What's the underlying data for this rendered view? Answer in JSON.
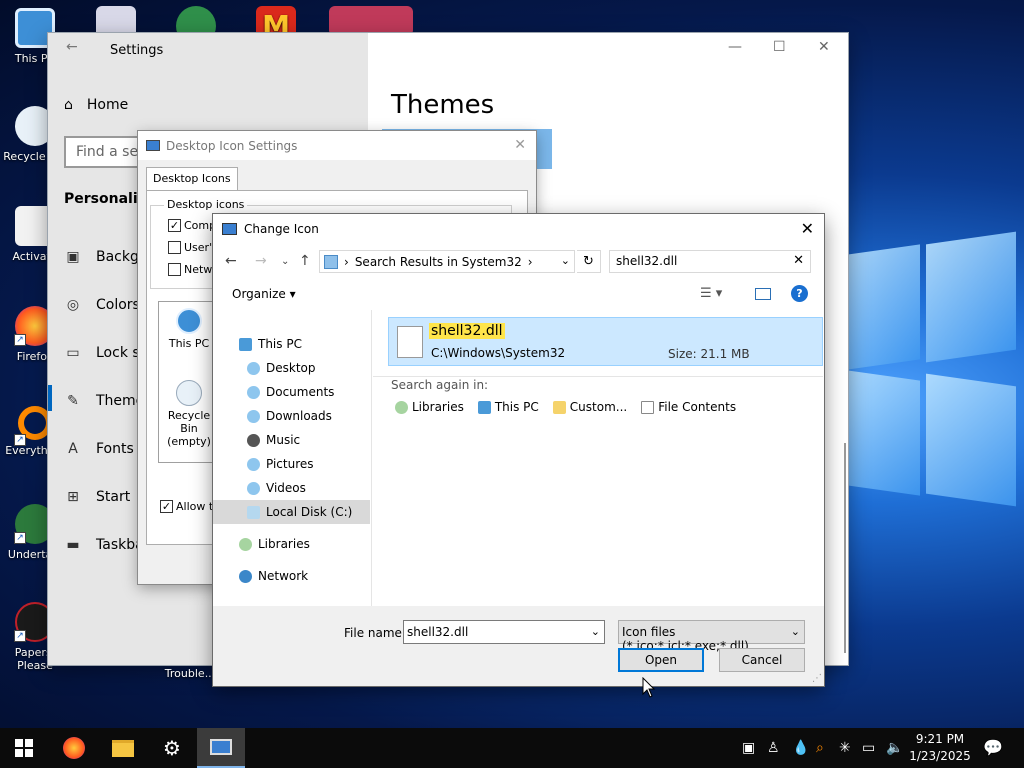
{
  "desktop": {
    "icons": [
      {
        "label": "This PC"
      },
      {
        "label": "Recycle Bin"
      },
      {
        "label": "Activate"
      },
      {
        "label": "Firefox"
      },
      {
        "label": "Everything"
      },
      {
        "label": "Undertale"
      },
      {
        "label": "Papers, Please"
      }
    ]
  },
  "settings": {
    "title": "Settings",
    "home_label": "Home",
    "search_placeholder": "Find a setting",
    "section_title": "Personalization",
    "nav_items": [
      {
        "label": "Background",
        "icon": "image-icon"
      },
      {
        "label": "Colors",
        "icon": "palette-icon"
      },
      {
        "label": "Lock screen",
        "icon": "lock-screen-icon"
      },
      {
        "label": "Themes",
        "icon": "themes-icon"
      },
      {
        "label": "Fonts",
        "icon": "fonts-icon"
      },
      {
        "label": "Start",
        "icon": "start-icon"
      },
      {
        "label": "Taskbar",
        "icon": "taskbar-icon"
      }
    ],
    "page_title": "Themes",
    "desktop_label": "Trouble..."
  },
  "desktop_icon_settings": {
    "title": "Desktop Icon Settings",
    "tab_label": "Desktop Icons",
    "group_label": "Desktop icons",
    "checkboxes": [
      {
        "label": "Computer",
        "checked": true
      },
      {
        "label": "User's Files",
        "checked": false
      },
      {
        "label": "Network",
        "checked": false
      }
    ],
    "preview_items": [
      "This PC",
      "Recycle Bin (empty)"
    ],
    "allow_label": "Allow themes to change desktop icons",
    "allow_checked": true
  },
  "change_icon": {
    "title": "Change Icon",
    "breadcrumb": "Search Results in System32",
    "search_value": "shell32.dll",
    "organize_label": "Organize",
    "nav": [
      {
        "label": "This PC",
        "level": 0,
        "selected": false
      },
      {
        "label": "Desktop",
        "level": 1,
        "selected": false
      },
      {
        "label": "Documents",
        "level": 1,
        "selected": false
      },
      {
        "label": "Downloads",
        "level": 1,
        "selected": false
      },
      {
        "label": "Music",
        "level": 1,
        "selected": false
      },
      {
        "label": "Pictures",
        "level": 1,
        "selected": false
      },
      {
        "label": "Videos",
        "level": 1,
        "selected": false
      },
      {
        "label": "Local Disk (C:)",
        "level": 1,
        "selected": true
      },
      {
        "label": "Libraries",
        "level": 0,
        "selected": false
      },
      {
        "label": "Network",
        "level": 0,
        "selected": false
      }
    ],
    "result": {
      "name": "shell32.dll",
      "path": "C:\\Windows\\System32",
      "size_label": "Size:",
      "size": "21.1 MB"
    },
    "search_again_label": "Search again in:",
    "search_again_options": [
      "Libraries",
      "This PC",
      "Custom...",
      "File Contents"
    ],
    "file_name_label": "File name:",
    "file_name_value": "shell32.dll",
    "filter_value": "Icon files (*.ico;*.icl;*.exe;*.dll)",
    "open_label": "Open",
    "cancel_label": "Cancel"
  },
  "taskbar": {
    "time": "9:21 PM",
    "date": "1/23/2025"
  }
}
